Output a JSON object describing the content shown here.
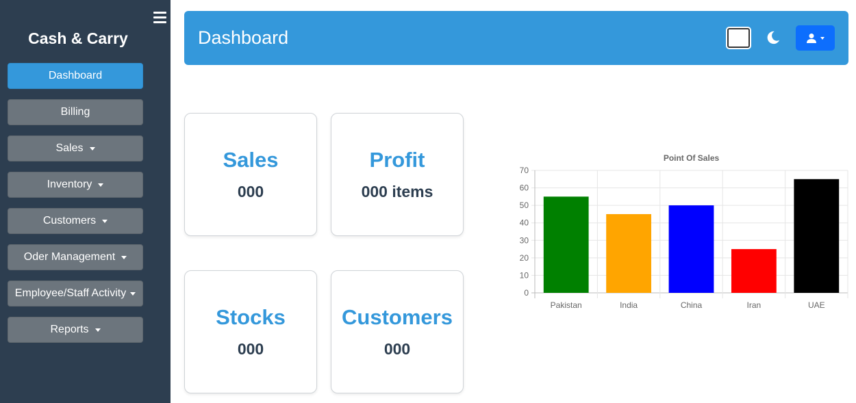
{
  "sidebar": {
    "brand": "Cash & Carry",
    "items": [
      {
        "label": "Dashboard",
        "active": true,
        "dropdown": false
      },
      {
        "label": "Billing",
        "active": false,
        "dropdown": false
      },
      {
        "label": "Sales",
        "active": false,
        "dropdown": true
      },
      {
        "label": "Inventory",
        "active": false,
        "dropdown": true
      },
      {
        "label": "Customers",
        "active": false,
        "dropdown": true
      },
      {
        "label": "Oder Management",
        "active": false,
        "dropdown": true
      },
      {
        "label": "Employee/Staff Activity",
        "active": false,
        "dropdown": true
      },
      {
        "label": "Reports",
        "active": false,
        "dropdown": true
      }
    ]
  },
  "header": {
    "title": "Dashboard",
    "icons": [
      "square-toggle",
      "moon-icon",
      "user-icon"
    ]
  },
  "cards": [
    {
      "title": "Sales",
      "value": "000"
    },
    {
      "title": "Profit",
      "value": "000 items"
    },
    {
      "title": "Stocks",
      "value": "000"
    },
    {
      "title": "Customers",
      "value": "000"
    }
  ],
  "colors": {
    "sidebar_bg": "#2d3e50",
    "accent": "#3498db",
    "nav_button": "#6c757d",
    "user_button": "#0d6efd"
  },
  "chart_data": {
    "type": "bar",
    "title": "Point Of Sales",
    "categories": [
      "Pakistan",
      "India",
      "China",
      "Iran",
      "UAE"
    ],
    "values": [
      55,
      45,
      50,
      25,
      65
    ],
    "colors": [
      "#008000",
      "#ffa500",
      "#0000ff",
      "#ff0000",
      "#000000"
    ],
    "ylim": [
      0,
      70
    ],
    "yticks": [
      0,
      10,
      20,
      30,
      40,
      50,
      60,
      70
    ],
    "grid": true,
    "xlabel": "",
    "ylabel": ""
  }
}
